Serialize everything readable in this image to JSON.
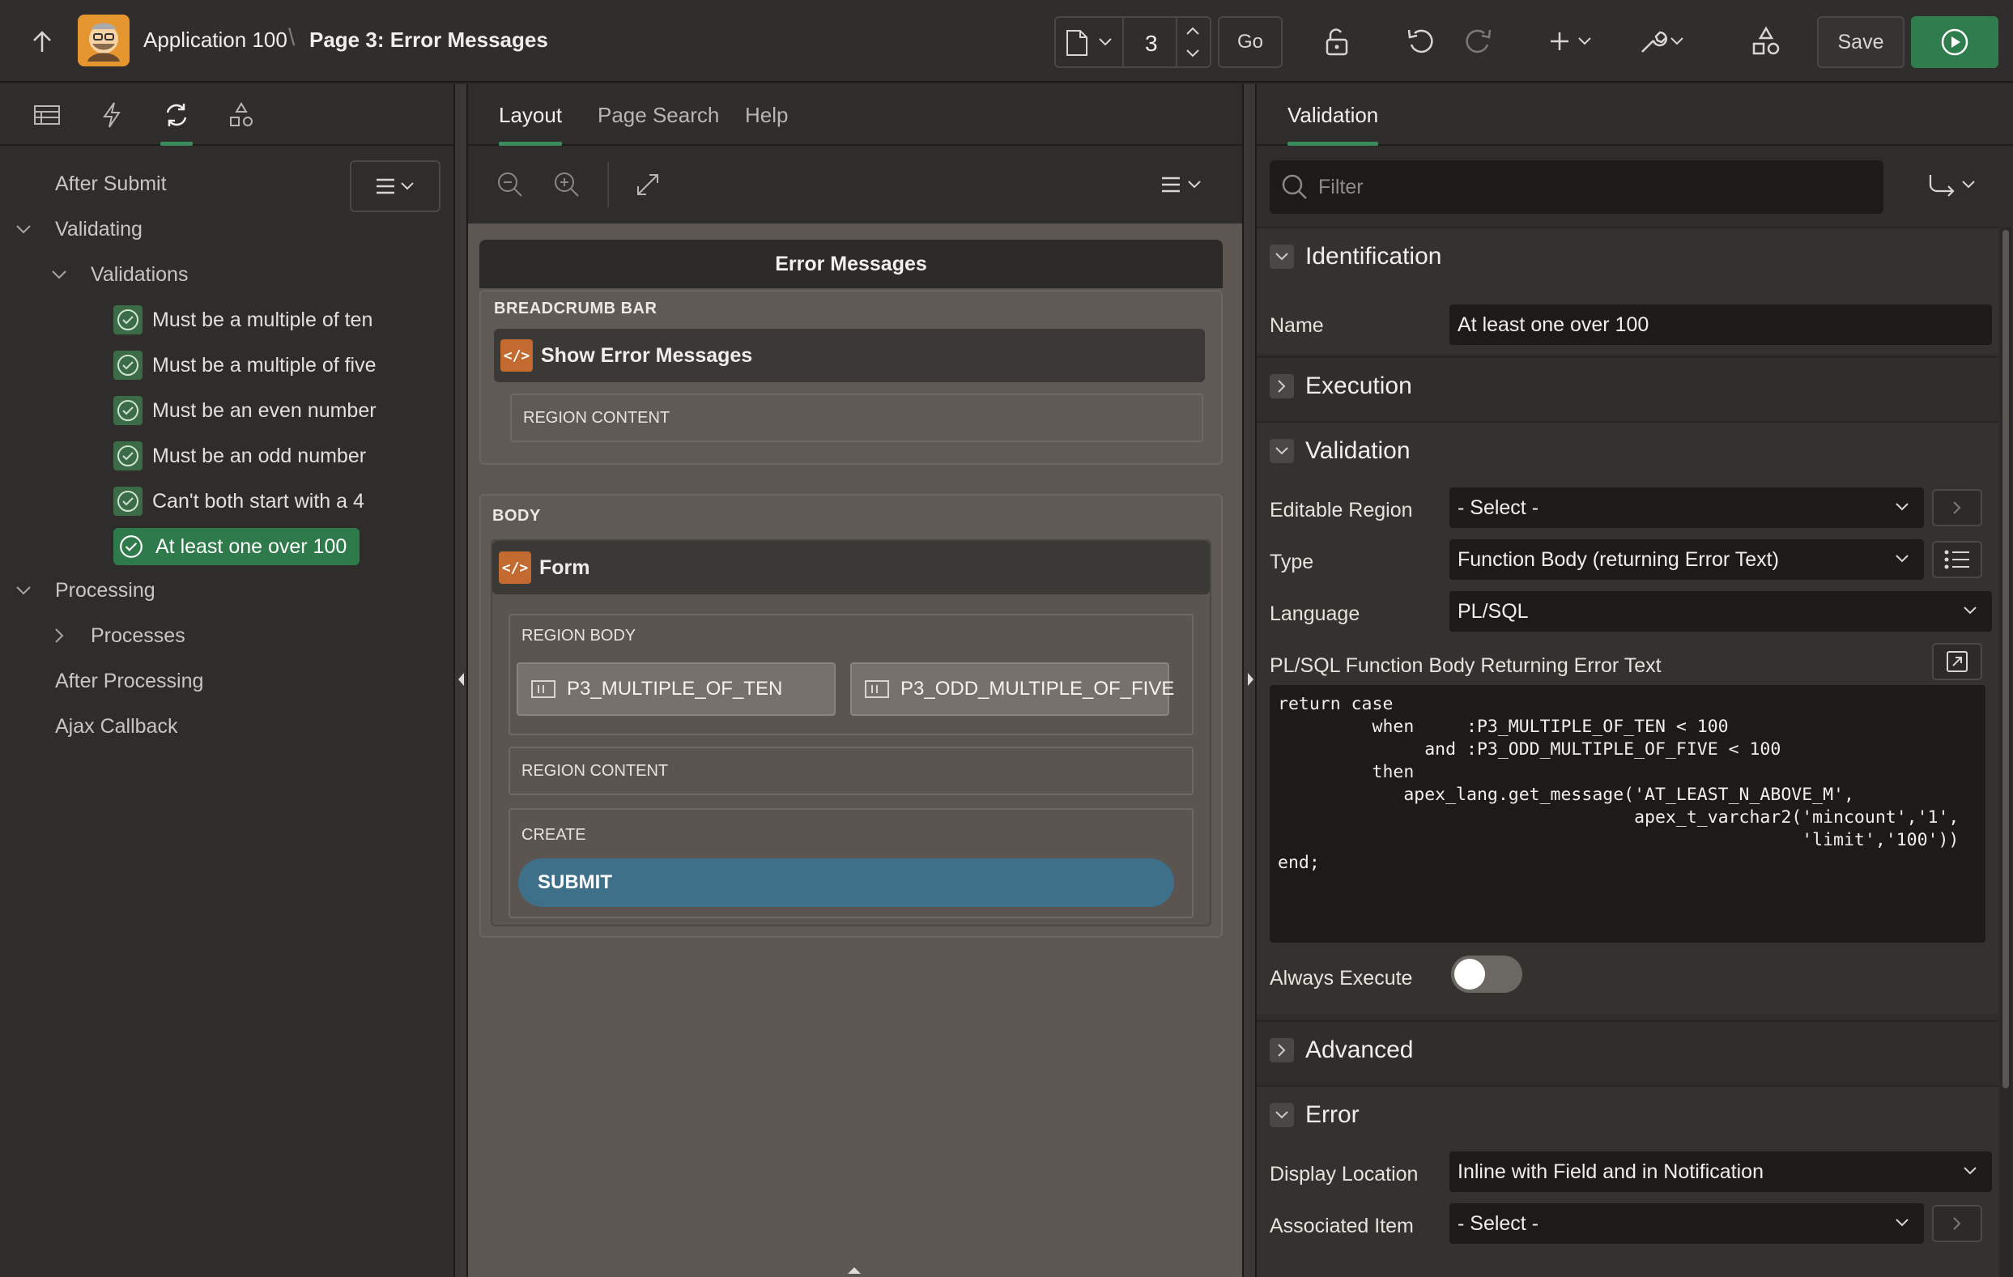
{
  "header": {
    "app": "Application 100",
    "separator": "\\",
    "page": "Page 3: Error Messages",
    "page_number": "3",
    "go": "Go",
    "save": "Save"
  },
  "left_tree": {
    "after_submit": "After Submit",
    "validating": "Validating",
    "validations": "Validations",
    "items": [
      "Must be a multiple of ten",
      "Must be a multiple of five",
      "Must be an even number",
      "Must be an odd number",
      "Can't both start with a 4",
      "At least one over 100"
    ],
    "processing": "Processing",
    "processes": "Processes",
    "after_processing": "After Processing",
    "ajax_callback": "Ajax Callback"
  },
  "mid": {
    "tabs": [
      "Layout",
      "Page Search",
      "Help"
    ],
    "page_title": "Error Messages",
    "breadcrumb_bar": "BREADCRUMB BAR",
    "show_error": "Show Error Messages",
    "region_content": "REGION CONTENT",
    "body": "BODY",
    "form": "Form",
    "region_body": "REGION BODY",
    "item1": "P3_MULTIPLE_OF_TEN",
    "item2": "P3_ODD_MULTIPLE_OF_FIVE",
    "region_content2": "REGION CONTENT",
    "create": "CREATE",
    "submit": "SUBMIT"
  },
  "right": {
    "tab": "Validation",
    "filter_placeholder": "Filter",
    "identification": "Identification",
    "name_label": "Name",
    "name_value": "At least one over 100",
    "execution": "Execution",
    "validation": "Validation",
    "editable_region_label": "Editable Region",
    "editable_region_value": "- Select -",
    "type_label": "Type",
    "type_value": "Function Body (returning Error Text)",
    "language_label": "Language",
    "language_value": "PL/SQL",
    "code_label": "PL/SQL Function Body Returning Error Text",
    "code": "return case\n         when     :P3_MULTIPLE_OF_TEN < 100\n              and :P3_ODD_MULTIPLE_OF_FIVE < 100\n         then\n            apex_lang.get_message('AT_LEAST_N_ABOVE_M',\n                                  apex_t_varchar2('mincount','1',\n                                                  'limit','100'))\nend;",
    "always_execute_label": "Always Execute",
    "always_execute": false,
    "advanced": "Advanced",
    "error": "Error",
    "display_location_label": "Display Location",
    "display_location_value": "Inline with Field and in Notification",
    "associated_item_label": "Associated Item",
    "associated_item_value": "- Select -"
  },
  "colors": {
    "accent": "#3a8c5c",
    "run_button": "#2f7d4c",
    "submit": "#3e7189"
  }
}
